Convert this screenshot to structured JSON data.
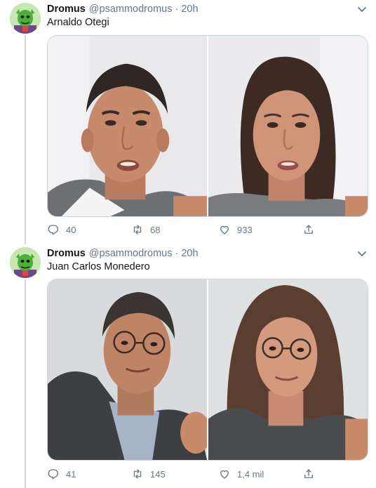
{
  "tweets": [
    {
      "author_name": "Dromus",
      "author_handle": "@psammodromus",
      "separator": "·",
      "time": "20h",
      "text": "Arnaldo Otegi",
      "reply_count": "40",
      "retweet_count": "68",
      "like_count": "933"
    },
    {
      "author_name": "Dromus",
      "author_handle": "@psammodromus",
      "separator": "·",
      "time": "20h",
      "text": "Juan Carlos Monedero",
      "reply_count": "41",
      "retweet_count": "145",
      "like_count": "1,4 mil"
    }
  ],
  "icons": {
    "reply": "reply-icon",
    "retweet": "retweet-icon",
    "like": "heart-icon",
    "share": "share-icon",
    "caret": "chevron-down-icon"
  },
  "colors": {
    "text": "#14171a",
    "secondary": "#657786",
    "border": "#ccd6dd"
  }
}
